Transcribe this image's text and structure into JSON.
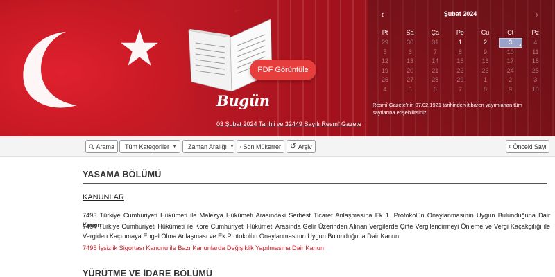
{
  "hero": {
    "pdf_button": "PDF Görüntüle",
    "today_title": "Bugün",
    "today_link": "03 Şubat 2024 Tarihli ve 32449 Sayılı Resmî Gazete",
    "note": "Resmî Gazete'nin 07.02.1921 tarihinden itibaren yayımlanan tüm sayılarına erişebilirsiniz."
  },
  "calendar": {
    "prev": "‹",
    "next": "›",
    "month_title": "Şubat 2024",
    "weekdays": [
      "Pt",
      "Sa",
      "Ça",
      "Pe",
      "Cu",
      "Ct",
      "Pz"
    ],
    "weeks": [
      [
        "29",
        "30",
        "31",
        "1",
        "2",
        "3",
        "4"
      ],
      [
        "5",
        "6",
        "7",
        "8",
        "9",
        "10",
        "11"
      ],
      [
        "12",
        "13",
        "14",
        "15",
        "16",
        "17",
        "18"
      ],
      [
        "19",
        "20",
        "21",
        "22",
        "23",
        "24",
        "25"
      ],
      [
        "26",
        "27",
        "28",
        "29",
        "1",
        "2",
        "3"
      ],
      [
        "4",
        "5",
        "6",
        "7",
        "8",
        "9",
        "10"
      ]
    ]
  },
  "toolbar": {
    "search": "Arama",
    "categories": "Tüm Kategoriler",
    "time_range": "Zaman Aralığı",
    "previous_issues": "Son Mükerrer",
    "archive": "Arşiv",
    "previous_day": "Önceki Sayı"
  },
  "content": {
    "section1": "YASAMA BÖLÜMÜ",
    "subsection1": "KANUNLAR",
    "laws": [
      "7493 Türkiye Cumhuriyeti Hükümeti ile Malezya Hükümeti Arasındaki Serbest Ticaret Anlaşmasına Ek 1. Protokolün Onaylanmasının Uygun Bulunduğuna Dair Kanun",
      "7494 Türkiye Cumhuriyeti Hükümeti ile Kore Cumhuriyeti Hükümeti Arasında Gelir Üzerinden Alınan Vergilerde Çifte Vergilendirmeyi Önleme ve Vergi Kaçakçılığı ile Vergiden Kaçınmaya Engel Olma Anlaşması ve Ek Protokolün Onaylanmasının Uygun Bulunduğuna Dair Kanun",
      "7495 İşsizlik Sigortası Kanunu ile Bazı Kanunlarda Değişiklik Yapılmasına Dair Kanun"
    ],
    "section2": "YÜRÜTME VE İDARE BÖLÜMÜ"
  },
  "colors": {
    "hero_red": "#c01a26",
    "button_red": "#e63d3d",
    "link_red": "#c81c2a",
    "selected_day": "#9aa3c8"
  }
}
